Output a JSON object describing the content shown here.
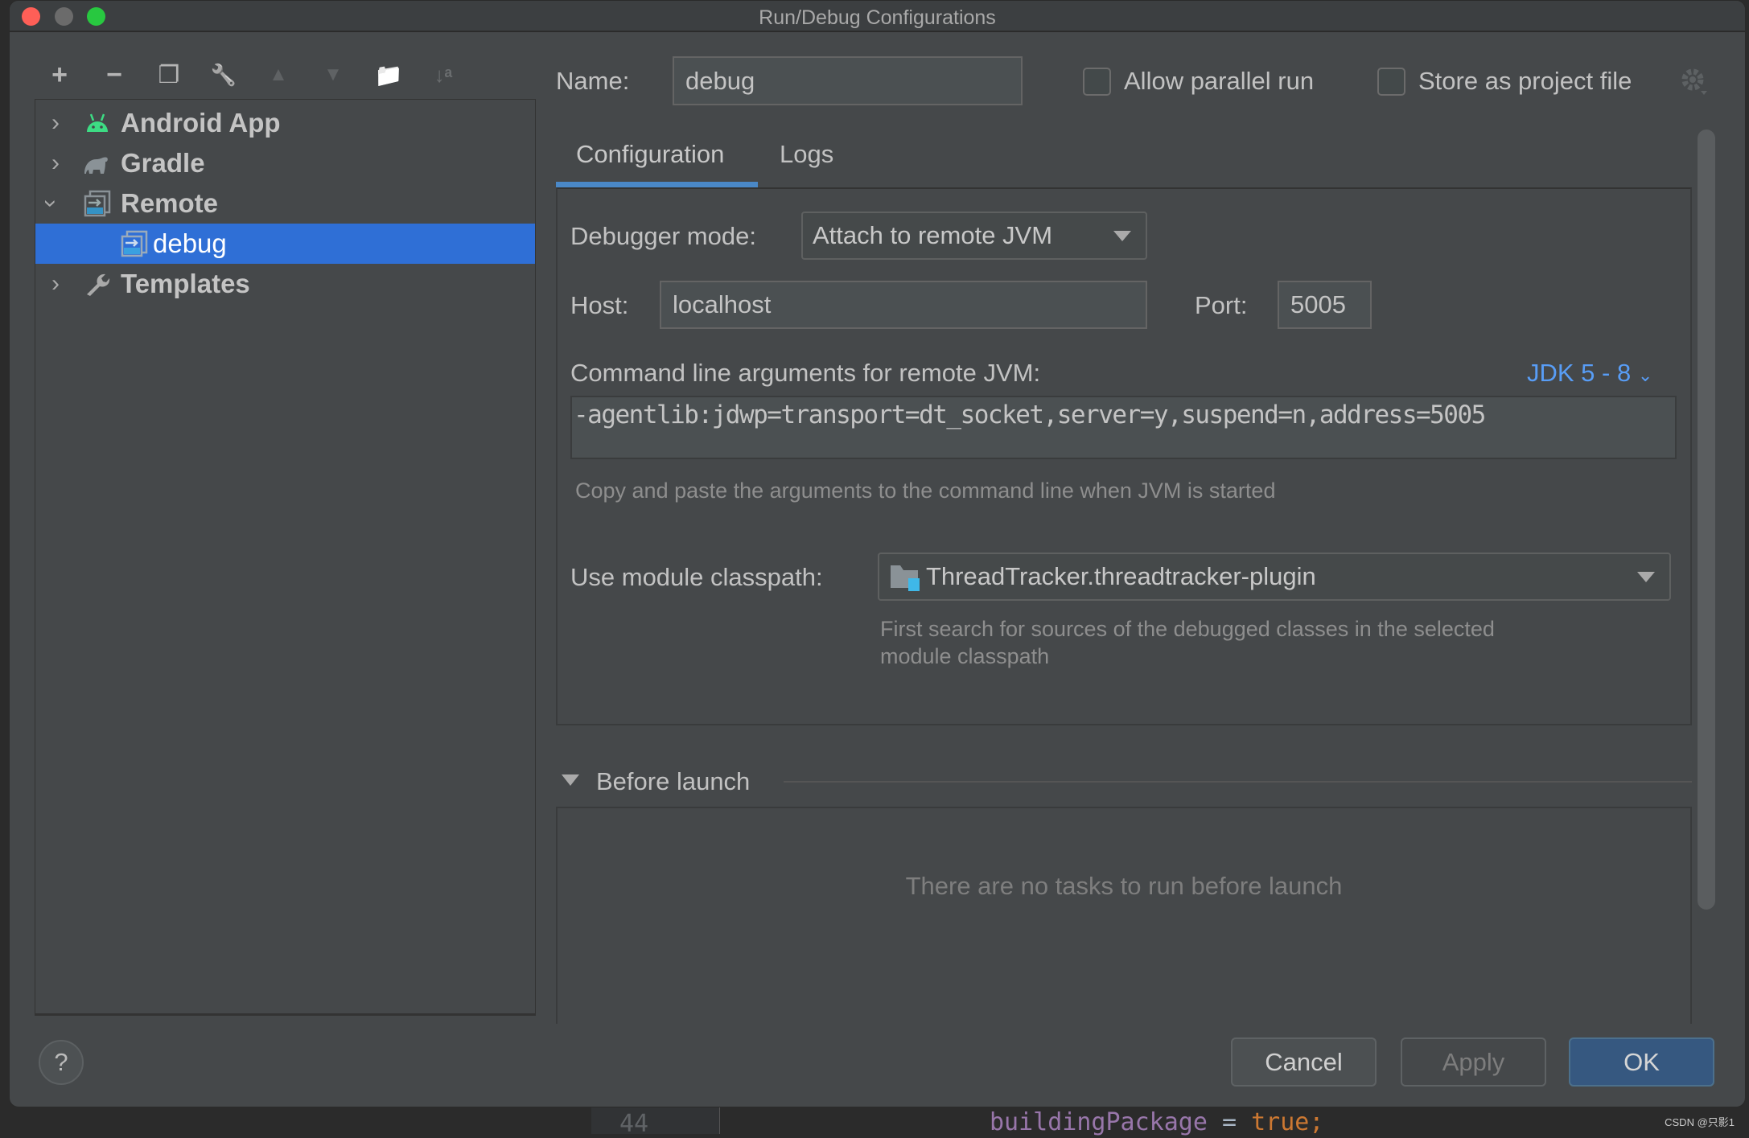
{
  "window": {
    "title": "Run/Debug Configurations",
    "lights": {
      "close": "#fe5f57",
      "minimize": "#6b6b6b",
      "zoom": "#28c840"
    }
  },
  "toolbar": {
    "icons": [
      "add-icon",
      "remove-icon",
      "copy-icon",
      "wrench-icon",
      "move-up-icon",
      "move-down-icon",
      "new-folder-icon",
      "sort-alpha-icon"
    ],
    "glyphs": [
      "+",
      "−",
      "❐",
      "🔧",
      "▲",
      "▼",
      "📁",
      "↓ᵃ"
    ]
  },
  "tree": {
    "items": [
      {
        "label": "Android App",
        "icon": "android-icon",
        "expanded": false
      },
      {
        "label": "Gradle",
        "icon": "gradle-elephant-icon",
        "expanded": false
      },
      {
        "label": "Remote",
        "icon": "remote-icon",
        "expanded": true
      },
      {
        "label": "debug",
        "icon": "remote-icon",
        "selected": true
      },
      {
        "label": "Templates",
        "icon": "wrench-icon",
        "expanded": false
      }
    ],
    "selected_color": "#2f6fd6"
  },
  "header": {
    "name_label": "Name:",
    "name_value": "debug",
    "allow_parallel_label": "Allow parallel run",
    "allow_parallel_checked": false,
    "store_project_label": "Store as project file",
    "store_project_checked": false
  },
  "tabs": [
    {
      "label": "Configuration",
      "active": true
    },
    {
      "label": "Logs",
      "active": false
    }
  ],
  "config": {
    "debugger_mode_label": "Debugger mode:",
    "debugger_mode_value": "Attach to remote JVM",
    "host_label": "Host:",
    "host_value": "localhost",
    "port_label": "Port:",
    "port_value": "5005",
    "cmd_label": "Command line arguments for remote JVM:",
    "jdk_link": "JDK 5 - 8",
    "cmd_value": "-agentlib:jdwp=transport=dt_socket,server=y,suspend=n,address=5005",
    "cmd_hint": "Copy and paste the arguments to the command line when JVM is started",
    "module_label": "Use module classpath:",
    "module_value": "ThreadTracker.threadtracker-plugin",
    "module_hint_1": "First search for sources of the debugged classes in the selected",
    "module_hint_2": "module classpath"
  },
  "before_launch": {
    "title": "Before launch",
    "empty_text": "There are no tasks to run before launch"
  },
  "footer": {
    "help": "?",
    "cancel": "Cancel",
    "apply": "Apply",
    "ok": "OK",
    "accent": "#365880"
  },
  "background_editor": {
    "line_number": "44",
    "code_var": "buildingPackage",
    "code_op": " = ",
    "code_val": "true;"
  },
  "watermark": "CSDN @只影1"
}
